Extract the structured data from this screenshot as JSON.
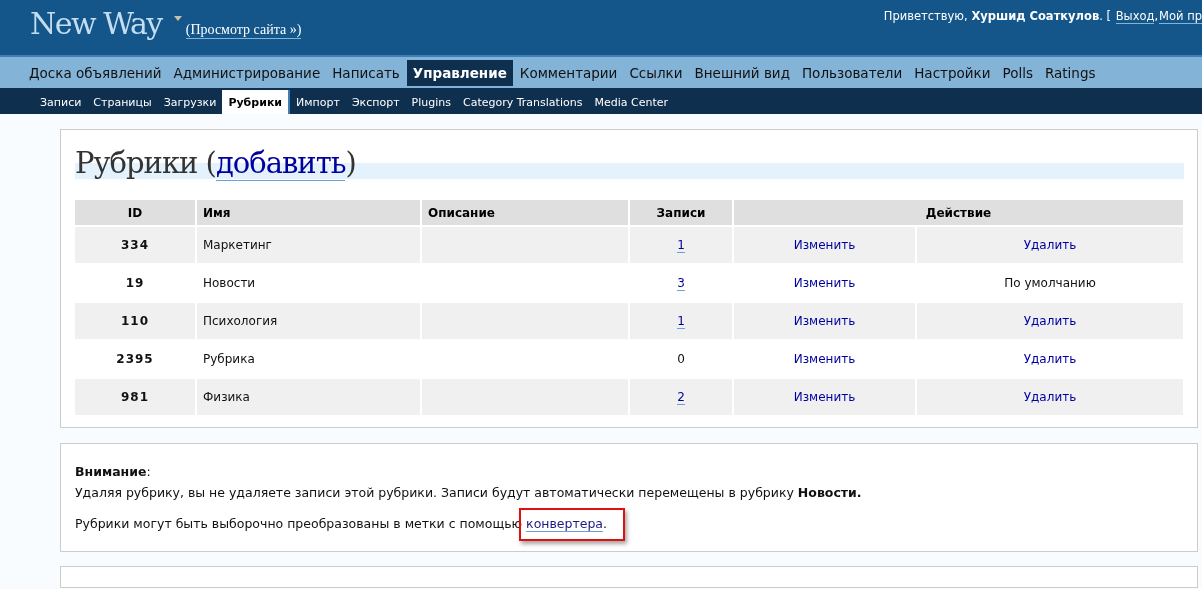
{
  "header": {
    "site_title": "New Way",
    "view_site": "(Просмотр сайта »)",
    "greeting": "Приветствую, **Хуршид Соаткулов**. [",
    "links": [
      "Выход",
      ",",
      "Мой пр"
    ]
  },
  "main_menu": [
    {
      "label": "Доска объявлений",
      "selected": false
    },
    {
      "label": "Администрирование",
      "selected": false
    },
    {
      "label": "Написать",
      "selected": false
    },
    {
      "label": "Управление",
      "selected": true
    },
    {
      "label": "Комментарии",
      "selected": false
    },
    {
      "label": "Ссылки",
      "selected": false
    },
    {
      "label": "Внешний вид",
      "selected": false
    },
    {
      "label": "Пользователи",
      "selected": false
    },
    {
      "label": "Настройки",
      "selected": false
    },
    {
      "label": "Polls",
      "selected": false
    },
    {
      "label": "Ratings",
      "selected": false
    }
  ],
  "sub_menu": [
    {
      "label": "Записи",
      "selected": false
    },
    {
      "label": "Страницы",
      "selected": false
    },
    {
      "label": "Загрузки",
      "selected": false
    },
    {
      "label": "Рубрики",
      "selected": true
    },
    {
      "label": "Импорт",
      "selected": false
    },
    {
      "label": "Экспорт",
      "selected": false
    },
    {
      "label": "Plugins",
      "selected": false
    },
    {
      "label": "Category Translations",
      "selected": false
    },
    {
      "label": "Media Center",
      "selected": false
    }
  ],
  "page": {
    "title": "Рубрики (",
    "add_link": "добавить",
    "title_end": ")"
  },
  "table": {
    "columns": [
      "ID",
      "Имя",
      "Описание",
      "Записи",
      "Действие"
    ],
    "rows": [
      {
        "id": "334",
        "name": "Маркетинг",
        "posts": "1",
        "posts_link": true,
        "edit": "Изменить",
        "delete": "Удалить",
        "delete_link": true
      },
      {
        "id": "19",
        "name": "Новости",
        "posts": "3",
        "posts_link": true,
        "edit": "Изменить",
        "delete": "По умолчанию",
        "delete_link": false
      },
      {
        "id": "110",
        "name": "Психология",
        "posts": "1",
        "posts_link": true,
        "edit": "Изменить",
        "delete": "Удалить",
        "delete_link": true
      },
      {
        "id": "2395",
        "name": "Рубрика",
        "posts": "0",
        "posts_link": false,
        "edit": "Изменить",
        "delete": "Удалить",
        "delete_link": true
      },
      {
        "id": "981",
        "name": "Физика",
        "posts": "2",
        "posts_link": true,
        "edit": "Изменить",
        "delete": "Удалить",
        "delete_link": true
      }
    ]
  },
  "notice": {
    "heading": "**Внимание**:",
    "text": "Удаляя рубрику, вы не удаляете записи этой рубрики. Записи будут автоматически перемещены в рубрику **Новости.**",
    "convert_text": "Рубрики могут быть выборочно преобразованы в метки с помощью",
    "convert_link": "конвертера",
    "convert_end": ".",
    "highlighted": true
  }
}
